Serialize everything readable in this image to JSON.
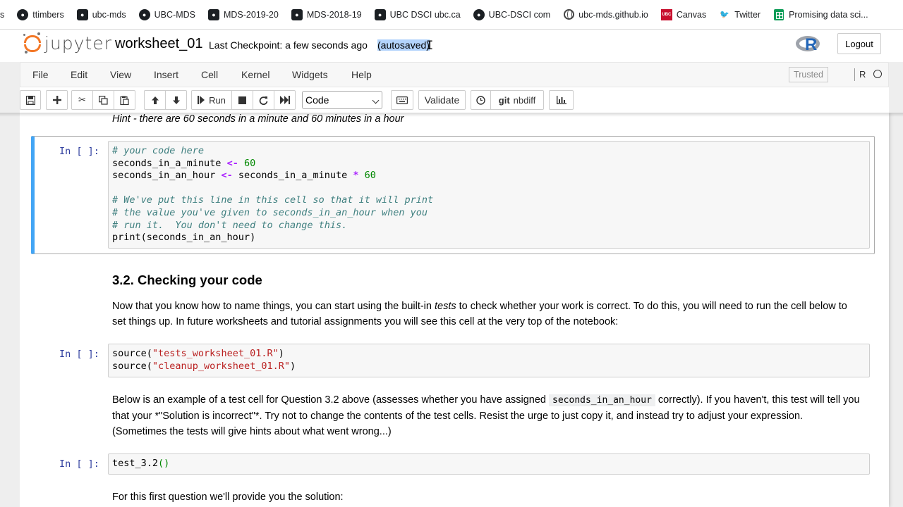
{
  "bookmarks": [
    {
      "label": "s",
      "icon": "truncated"
    },
    {
      "label": "ttimbers",
      "icon": "github-icon"
    },
    {
      "label": "ubc-mds",
      "icon": "github-org-icon"
    },
    {
      "label": "UBC-MDS",
      "icon": "github-icon"
    },
    {
      "label": "MDS-2019-20",
      "icon": "github-org-icon"
    },
    {
      "label": "MDS-2018-19",
      "icon": "github-org-icon"
    },
    {
      "label": "UBC DSCI ubc.ca",
      "icon": "github-org-icon"
    },
    {
      "label": "UBC-DSCI com",
      "icon": "github-icon"
    },
    {
      "label": "ubc-mds.github.io",
      "icon": "globe-icon"
    },
    {
      "label": "Canvas",
      "icon": "canvas-icon"
    },
    {
      "label": "Twitter",
      "icon": "twitter-icon"
    },
    {
      "label": "Promising data sci...",
      "icon": "sheets-icon"
    }
  ],
  "header": {
    "logo_text": "jupyter",
    "notebook_name": "worksheet_01",
    "checkpoint": "Last Checkpoint: a few seconds ago",
    "autosaved": "(autosaved)",
    "kernel_logo": "R",
    "logout_label": "Logout"
  },
  "menubar": {
    "items": [
      "File",
      "Edit",
      "View",
      "Insert",
      "Cell",
      "Kernel",
      "Widgets",
      "Help"
    ],
    "trusted_label": "Trusted",
    "kernel_name": "R"
  },
  "toolbar": {
    "run_label": "Run",
    "cell_type": "Code",
    "validate_label": "Validate",
    "nbdiff_label": "nbdiff",
    "git_label": "git"
  },
  "notebook": {
    "hint": "Hint - there are 60 seconds in a minute and 60 minutes in a hour",
    "prompt": "In [ ]:",
    "cell1_lines": [
      "# your code here",
      "seconds_in_a_minute <- 60",
      "seconds_in_an_hour <- seconds_in_a_minute * 60",
      "",
      "# We've put this line in this cell so that it will print",
      "# the value you've given to seconds_in_an_hour when you",
      "# run it.  You don't need to change this.",
      "print(seconds_in_an_hour)"
    ],
    "heading": "3.2. Checking your code",
    "para1_a": "Now that you know how to name things, you can start using the built-in ",
    "para1_em": "tests",
    "para1_b": " to check whether your work is correct. To do this, you will need to run the cell below to set things up. In future worksheets and tutorial assignments you will see this cell at the very top of the notebook:",
    "cell2_lines": [
      "source(\"tests_worksheet_01.R\")",
      "source(\"cleanup_worksheet_01.R\")"
    ],
    "para2_a": "Below is an example of a test cell for Question 3.2 above (assesses whether you have assigned ",
    "para2_code": "seconds_in_an_hour",
    "para2_b": " correctly). If you haven't, this test will tell you that your *\"Solution is incorrect\"*. Try not to change the contents of the test cells. Resist the urge to just copy it, and instead try to adjust your expression. (Sometimes the tests will give hints about what went wrong...)",
    "cell3_line": "test_3.2()",
    "para3": "For this first question we'll provide you the solution:"
  },
  "colors": {
    "jupyter_orange": "#f37726",
    "selected_cell_bar": "#42a5f5",
    "prompt_blue": "#303f9f"
  }
}
